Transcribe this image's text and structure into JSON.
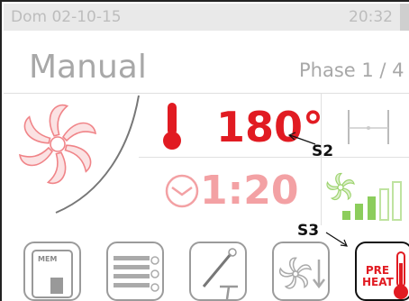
{
  "status": {
    "date": "Dom 02-10-15",
    "time": "20:32"
  },
  "header": {
    "mode": "Manual",
    "phase": "Phase 1 / 4"
  },
  "cooking": {
    "temperature": "180°",
    "duration": "1:20"
  },
  "annotations": {
    "s2": "S2",
    "s3": "S3"
  },
  "toolbar": {
    "memory_label": "MEM",
    "preheat_label_line1": "PRE",
    "preheat_label_line2": "HEAT"
  },
  "colors": {
    "accent": "#e11b22",
    "accent_light": "#f3a1a4",
    "green_light": "#bfe3a0",
    "green": "#8ccd5c",
    "gray": "#a8a8a8"
  },
  "icons": [
    "fan-icon",
    "thermometer-icon",
    "timer-icon",
    "probe-icon",
    "fan-speed-icon",
    "signal-bars-icon",
    "memory-icon",
    "program-list-icon",
    "core-probe-icon",
    "fan-cooldown-icon",
    "preheat-icon"
  ]
}
